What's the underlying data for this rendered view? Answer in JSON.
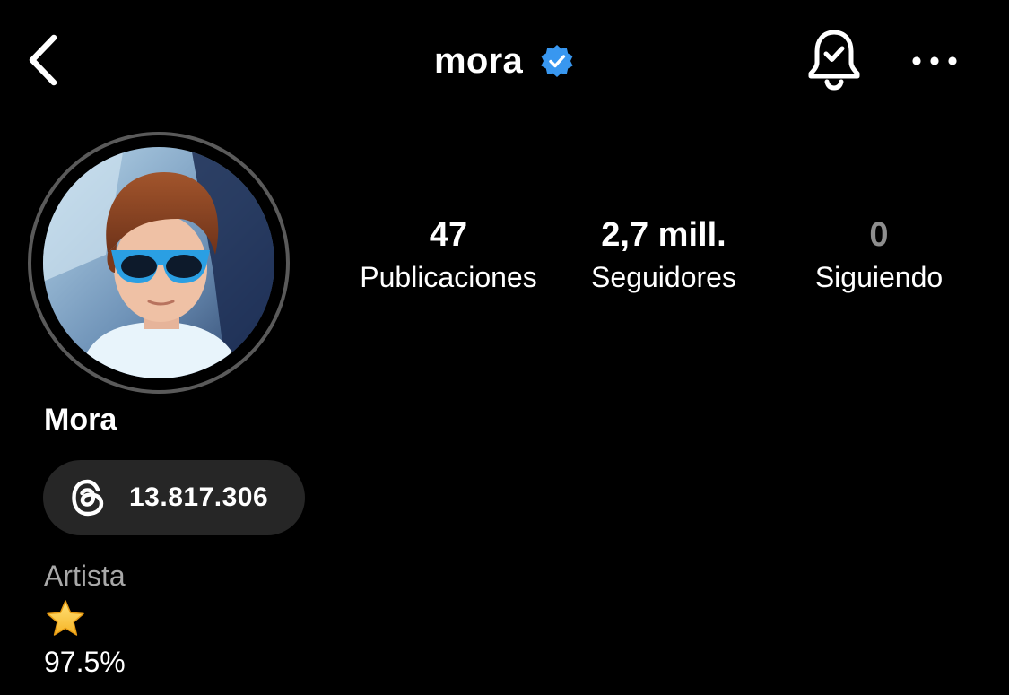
{
  "header": {
    "username": "mora",
    "verified": true,
    "accent_color": "#3897f0"
  },
  "icons": {
    "back": "chevron-left-icon",
    "notifications": "bell-check-icon",
    "more": "more-horizontal-icon",
    "verified": "verified-badge-icon",
    "threads": "threads-logo-icon",
    "bio_emoji": "star-icon"
  },
  "profile": {
    "display_name": "Mora",
    "avatar_description": "avatar-photo"
  },
  "stats": {
    "posts": {
      "value": "47",
      "label": "Publicaciones"
    },
    "followers": {
      "value": "2,7 mill.",
      "label": "Seguidores"
    },
    "following": {
      "value": "0",
      "label": "Siguiendo"
    }
  },
  "threads_badge": {
    "count": "13.817.306"
  },
  "bio": {
    "category": "Artista",
    "line2": "97.5%"
  }
}
